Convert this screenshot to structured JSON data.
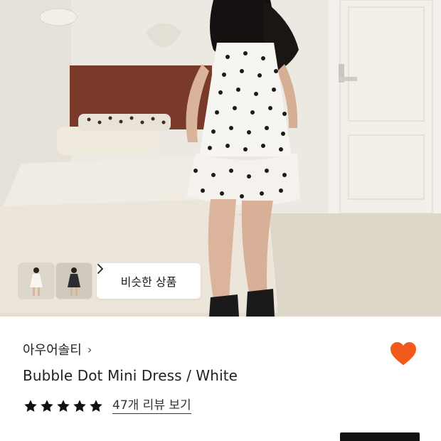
{
  "hero": {
    "thumbnails": [
      {
        "icon": "white-dress-thumbnail"
      },
      {
        "icon": "black-dress-thumbnail"
      }
    ],
    "similar_button": {
      "label": "비슷한 상품",
      "icon": "chevron-right-icon"
    }
  },
  "product": {
    "brand": "아우어솔티",
    "brand_chevron": "›",
    "title": "Bubble Dot Mini Dress / White",
    "rating": {
      "stars": 5,
      "max": 5,
      "review_link": "47개 리뷰 보기"
    },
    "liked": true
  },
  "colors": {
    "heart": "#f25a1c",
    "text": "#222222",
    "star": "#111111"
  }
}
